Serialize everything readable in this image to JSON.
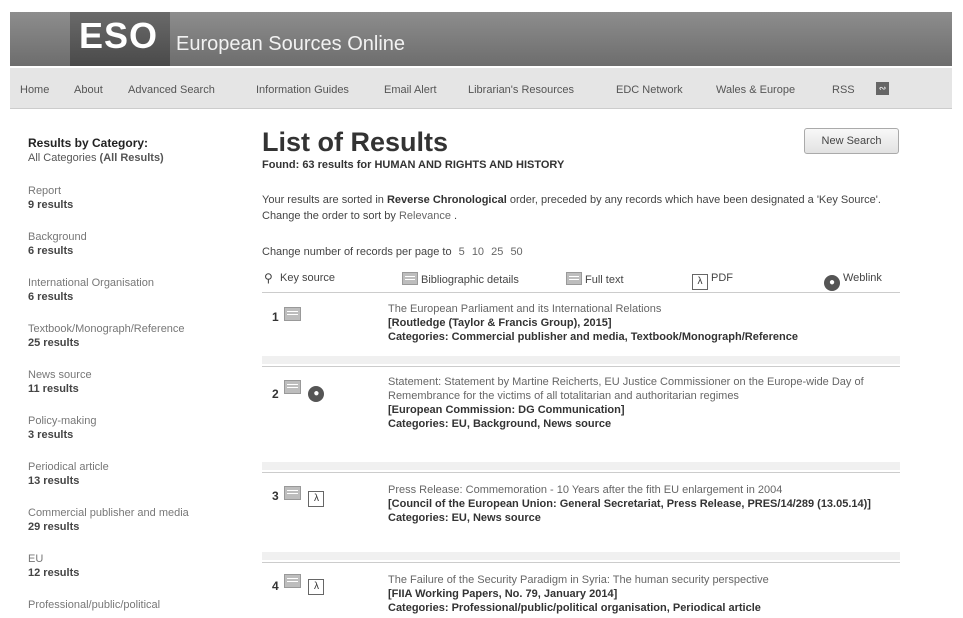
{
  "header": {
    "logo_short": "ESO",
    "logo_full": "European Sources Online"
  },
  "nav": {
    "items": [
      "Home",
      "About",
      "Advanced Search",
      "Information Guides",
      "Email Alert",
      "Librarian's Resources",
      "EDC Network",
      "Wales & Europe",
      "RSS"
    ]
  },
  "sidebar": {
    "heading": "Results by Category:",
    "all_label": "All Categories",
    "all_suffix": "(All Results)",
    "categories": [
      {
        "name": "Report",
        "count": "9 results"
      },
      {
        "name": "Background",
        "count": "6 results"
      },
      {
        "name": "International Organisation",
        "count": "6 results"
      },
      {
        "name": "Textbook/Monograph/Reference",
        "count": "25 results"
      },
      {
        "name": "News source",
        "count": "11 results"
      },
      {
        "name": "Policy-making",
        "count": "3 results"
      },
      {
        "name": "Periodical article",
        "count": "13 results"
      },
      {
        "name": "Commercial publisher and media",
        "count": "29 results"
      },
      {
        "name": "EU",
        "count": "12 results"
      },
      {
        "name": "Professional/public/political",
        "count": ""
      }
    ]
  },
  "main": {
    "title": "List of Results",
    "found": "Found: 63 results for HUMAN AND RIGHTS AND HISTORY",
    "new_search": "New Search",
    "sort_prefix": "Your results are sorted in",
    "sort_order": "Reverse Chronological",
    "sort_middle": "order, preceded by any records which have been designated a 'Key Source'. Change the order to sort by",
    "sort_alt": "Relevance",
    "sort_end": ".",
    "perpage_label": "Change number of records per page to",
    "perpage_options": [
      "5",
      "10",
      "25",
      "50"
    ],
    "legend": {
      "key_source": "Key source",
      "biblio": "Bibliographic details",
      "fulltext": "Full text",
      "pdf": "PDF",
      "weblink": "Weblink"
    },
    "results": [
      {
        "num": "1",
        "title": "The European Parliament and its International Relations",
        "source": "[Routledge (Taylor & Francis Group), 2015]",
        "categories_label": "Categories:",
        "categories": "Commercial publisher and media, Textbook/Monograph/Reference",
        "icons": [
          "doc-icon"
        ]
      },
      {
        "num": "2",
        "title": "Statement: Statement by Martine Reicherts, EU Justice Commissioner on the Europe-wide Day of Remembrance for the victims of all totalitarian and authoritarian regimes",
        "source": "[European Commission: DG Communication]",
        "categories_label": "Categories:",
        "categories": "EU, Background, News source",
        "icons": [
          "doc-icon",
          "globe-icon"
        ]
      },
      {
        "num": "3",
        "title": "Press Release: Commemoration - 10 Years after the fith EU enlargement in 2004",
        "source": "[Council of the European Union: General Secretariat, Press Release, PRES/14/289 (13.05.14)]",
        "categories_label": "Categories:",
        "categories": "EU, News source",
        "icons": [
          "doc-icon",
          "pdf-icon"
        ]
      },
      {
        "num": "4",
        "title": "The Failure of the Security Paradigm in Syria: The human security perspective",
        "source": "[FIIA Working Papers, No. 79, January 2014]",
        "categories_label": "Categories:",
        "categories": "Professional/public/political organisation, Periodical article",
        "icons": [
          "doc-icon",
          "pdf-icon"
        ]
      }
    ]
  },
  "colors": {
    "header_bg": "#7d7d7d",
    "nav_bg": "#e5e5e5",
    "link_gray": "#666666"
  }
}
